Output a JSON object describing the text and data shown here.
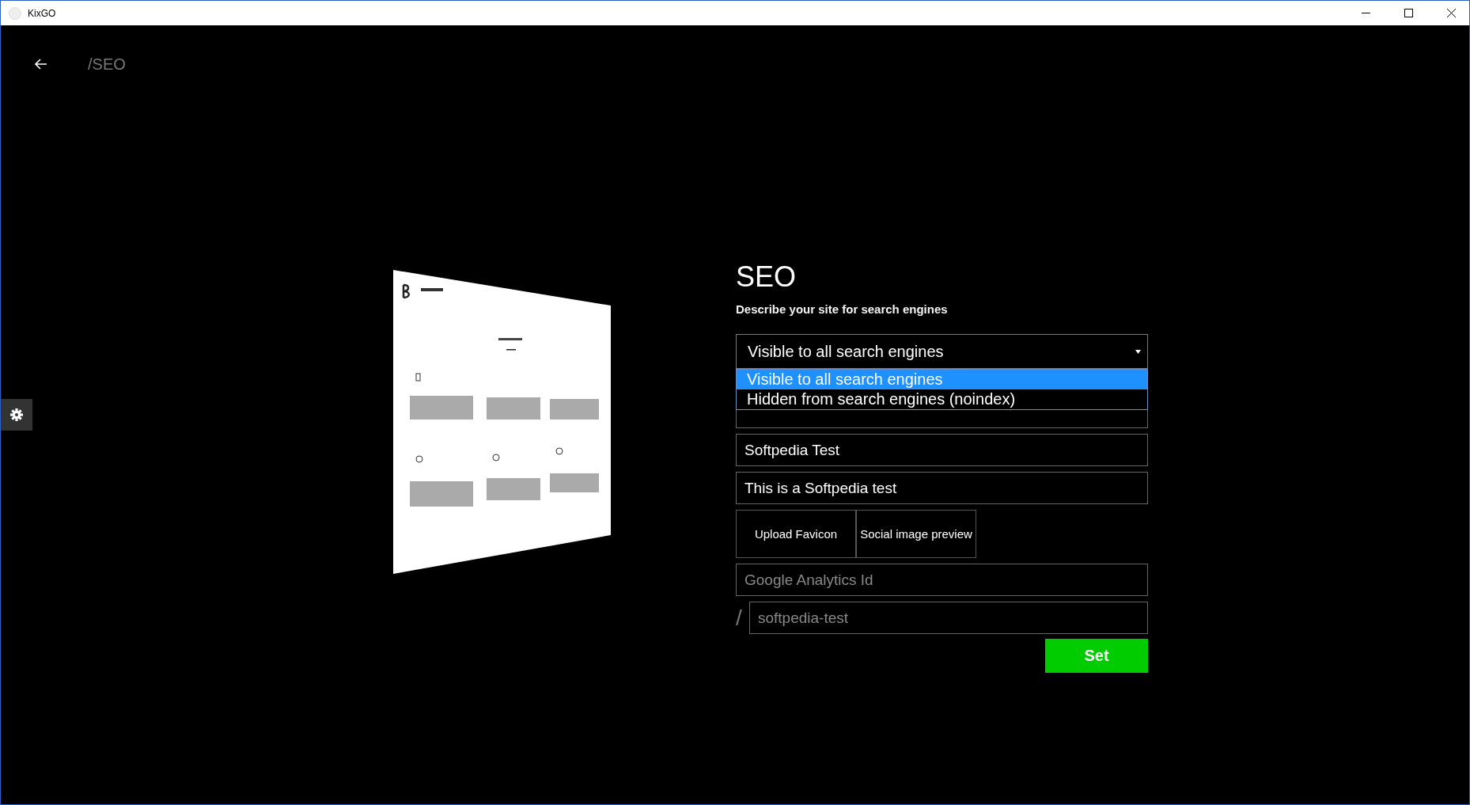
{
  "window": {
    "title": "KixGO"
  },
  "header": {
    "breadcrumb": "/SEO"
  },
  "form": {
    "title": "SEO",
    "subtitle": "Describe your site for search engines",
    "visibility": {
      "value": "Visible to all search engines",
      "expanded": true,
      "options": [
        {
          "label": "Visible to all search engines",
          "selected": true
        },
        {
          "label": "Hidden from search engines (noindex)",
          "selected": false
        }
      ]
    },
    "fields": [
      {
        "value": "Softpedia Test"
      },
      {
        "value": "This is a Softpedia test"
      }
    ],
    "buttons": [
      "Upload Favicon",
      "Social image preview"
    ],
    "analytics": {
      "placeholder": "Google Analytics Id"
    },
    "slug": {
      "prefix": "/",
      "placeholder": "softpedia-test"
    },
    "submit": "Set"
  }
}
